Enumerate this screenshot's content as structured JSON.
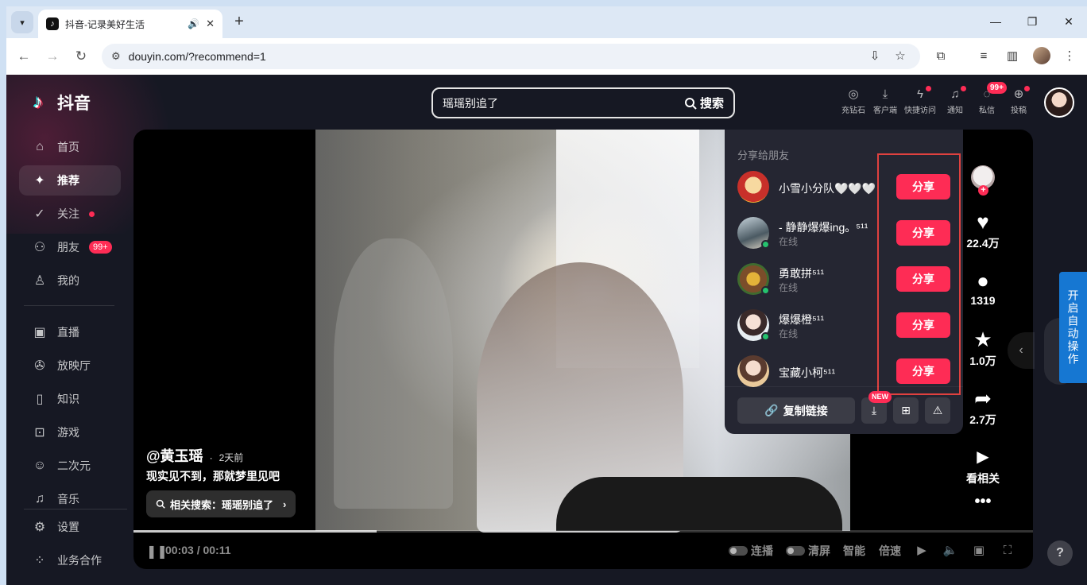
{
  "browser": {
    "tab_title": "抖音-记录美好生活",
    "url": "douyin.com/?recommend=1"
  },
  "header": {
    "logo_text": "抖音",
    "search": {
      "value": "瑶瑶别追了",
      "button_label": "搜索"
    },
    "actions": [
      {
        "label": "充钻石",
        "icon": "diamond-icon"
      },
      {
        "label": "客户端",
        "icon": "download-icon"
      },
      {
        "label": "快捷访问",
        "icon": "lightning-icon"
      },
      {
        "label": "通知",
        "icon": "bell-icon"
      },
      {
        "label": "私信",
        "icon": "message-icon",
        "badge": "99+"
      },
      {
        "label": "投稿",
        "icon": "upload-plus-icon"
      }
    ]
  },
  "sidebar": {
    "items": [
      {
        "label": "首页",
        "icon": "home-icon"
      },
      {
        "label": "推荐",
        "icon": "sparkle-icon",
        "active": true
      },
      {
        "label": "关注",
        "icon": "follow-icon"
      },
      {
        "label": "朋友",
        "icon": "friends-icon",
        "badge": "99+"
      },
      {
        "label": "我的",
        "icon": "user-icon"
      },
      {
        "label": "直播",
        "icon": "tv-icon"
      },
      {
        "label": "放映厅",
        "icon": "film-icon"
      },
      {
        "label": "知识",
        "icon": "book-icon"
      },
      {
        "label": "游戏",
        "icon": "gamepad-icon"
      },
      {
        "label": "二次元",
        "icon": "anime-icon"
      },
      {
        "label": "音乐",
        "icon": "music-icon"
      },
      {
        "label": "设置",
        "icon": "settings-icon"
      },
      {
        "label": "业务合作",
        "icon": "cooperation-icon"
      }
    ]
  },
  "video": {
    "author": "@黄玉瑶",
    "time_sep": "·",
    "post_time": "2天前",
    "description": "现实见不到，那就梦里见吧",
    "related_search": "相关搜索：瑶瑶别追了",
    "current_time": "00:03",
    "duration": "00:11",
    "time_display": "00:03 / 00:11",
    "progress": 0.27,
    "controls": {
      "autoplay": "连播",
      "clear_screen": "清屏",
      "smart": "智能",
      "speed": "倍速"
    }
  },
  "actions": {
    "likes": "22.4万",
    "comments": "1319",
    "favorites": "1.0万",
    "shares": "2.7万",
    "related": "看相关"
  },
  "share_panel": {
    "title": "分享给朋友",
    "share_label": "分享",
    "friends": [
      {
        "name": "小雪小分队🤍🤍🤍",
        "status": ""
      },
      {
        "name": "- 静静爆爆ing。⁵¹¹",
        "status": "在线"
      },
      {
        "name": "勇敢拼⁵¹¹",
        "status": "在线"
      },
      {
        "name": "爆爆橙⁵¹¹",
        "status": "在线"
      },
      {
        "name": "宝藏小柯⁵¹¹",
        "status": ""
      }
    ],
    "copy_link": "复制链接",
    "new_badge": "NEW"
  },
  "auto_operate": "开启自动操作",
  "help": "?"
}
